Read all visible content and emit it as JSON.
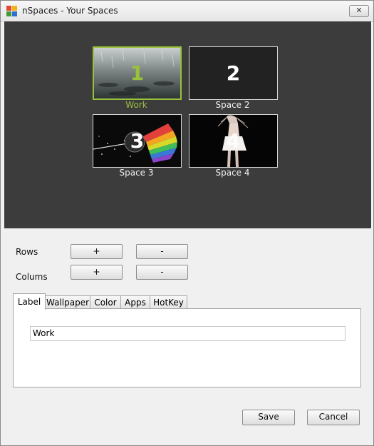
{
  "window": {
    "title": "nSpaces - Your Spaces",
    "close_glyph": "✕"
  },
  "spaces": [
    {
      "number": "1",
      "label": "Work",
      "active": true
    },
    {
      "number": "2",
      "label": "Space 2",
      "active": false
    },
    {
      "number": "3",
      "label": "Space 3",
      "active": false
    },
    {
      "number": "4",
      "label": "Space 4",
      "active": false
    }
  ],
  "grid": {
    "rows_label": "Rows",
    "columns_label": "Colums",
    "plus": "+",
    "minus": "-"
  },
  "tabs": [
    {
      "label": "Label",
      "active": true
    },
    {
      "label": "Wallpaper",
      "active": false
    },
    {
      "label": "Color",
      "active": false
    },
    {
      "label": "Apps",
      "active": false
    },
    {
      "label": "HotKey",
      "active": false
    }
  ],
  "label_field": {
    "value": "Work"
  },
  "footer": {
    "save": "Save",
    "cancel": "Cancel"
  },
  "colors": {
    "accent": "#9ac13c",
    "preview_bg": "#3c3c3c"
  }
}
